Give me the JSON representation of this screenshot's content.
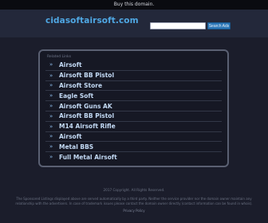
{
  "topbar": {
    "label": "Buy this domain."
  },
  "header": {
    "logo": "cidasoftairsoft.com",
    "search_placeholder": "",
    "search_button": "Search Ads"
  },
  "panel": {
    "related_label": "Related Links",
    "arrow_glyph": "»",
    "links": [
      "Airsoft",
      "Airsoft BB Pistol",
      "Airsoft Store",
      "Eagle Soft",
      "Airsoft Guns AK",
      "Airsoft BB Pistol",
      "M14 Airsoft Rifle",
      "Airsoft",
      "Metal BBS",
      "Full Metal Airsoft"
    ]
  },
  "footer": {
    "copyright": "2017 Copyright. All Rights Reserved.",
    "disclaimer": "The Sponsored Listings displayed above are served automatically by a third party. Neither the service provider nor the domain owner maintain any relationship with the advertisers. In case of trademark issues please contact the domain owner directly (contact information can be found in whois).",
    "privacy": "Privacy Policy"
  },
  "colors": {
    "background": "#1b1d2b",
    "header": "#23283a",
    "logo": "#4fa7e3",
    "link_text": "#c3daf5",
    "button": "#2e78b8"
  }
}
